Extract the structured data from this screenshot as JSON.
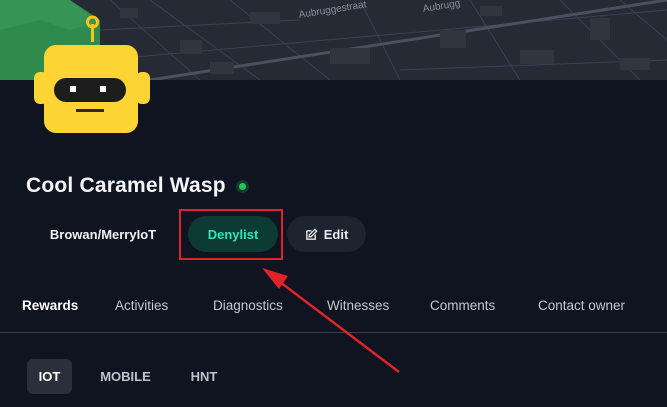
{
  "map": {
    "street_labels": [
      "Aubruggestraat",
      "Aubrugg"
    ]
  },
  "hotspot": {
    "name": "Cool Caramel Wasp",
    "status": "online",
    "maker": "Browan/MerryIoT",
    "denylist_label": "Denylist",
    "edit_label": "Edit"
  },
  "tabs": [
    {
      "label": "Rewards",
      "active": true
    },
    {
      "label": "Activities"
    },
    {
      "label": "Diagnostics"
    },
    {
      "label": "Witnesses"
    },
    {
      "label": "Comments"
    },
    {
      "label": "Contact owner"
    }
  ],
  "tokens": [
    {
      "label": "IOT",
      "active": true
    },
    {
      "label": "MOBILE"
    },
    {
      "label": "HNT"
    }
  ],
  "colors": {
    "background": "#0f1420",
    "accent_teal": "#2ee6b8",
    "status_green": "#22c55e",
    "annotation_red": "#e0222b",
    "avatar_yellow": "#fcd535"
  },
  "icons": {
    "edit": "pencil-square-icon",
    "status": "online-dot-icon"
  }
}
